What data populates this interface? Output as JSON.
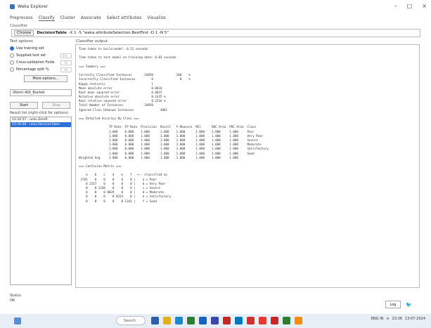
{
  "window": {
    "title": "Weka Explorer",
    "controls": [
      "–",
      "□",
      "×"
    ]
  },
  "tabs": [
    "Preprocess",
    "Classify",
    "Cluster",
    "Associate",
    "Select attributes",
    "Visualize"
  ],
  "active_tab": 1,
  "classifier": {
    "section_label": "Classifier",
    "choose_label": "Choose",
    "name": "DecisionTable",
    "options": "-X 1 -S \"weka.attributeSelection.BestFirst -D 1 -N 5\""
  },
  "test_options": {
    "label": "Test options",
    "items": [
      {
        "label": "Use training set",
        "selected": true,
        "value": ""
      },
      {
        "label": "Supplied test set",
        "selected": false,
        "value": "Set..."
      },
      {
        "label": "Cross-validation  Folds",
        "selected": false,
        "value": "10"
      },
      {
        "label": "Percentage split  %",
        "selected": false,
        "value": "66"
      }
    ],
    "more_options": "More options..."
  },
  "class_select": "(Nom) AQI_Bucket",
  "start_label": "Start",
  "stop_label": "Stop",
  "result_list": {
    "label": "Result list (right-click for options)",
    "items": [
      {
        "text": "23:34:57 - rules.ZeroR",
        "selected": false
      },
      {
        "text": "23:36:08 - rules.DecisionTable",
        "selected": true
      }
    ]
  },
  "output": {
    "label": "Classifier output",
    "lines": [
      "Time taken to build model: 0.11 seconds",
      "",
      "Time taken to test model on training data: 0.03 seconds",
      "",
      "=== Summary ===",
      "",
      "Correctly Classified Instances       24850             100    %",
      "Incorrectly Classified Instances         0               0    %",
      "Kappa statistic                          1",
      "Mean absolute error                      0.0034",
      "Root mean squared error                  0.0037",
      "Relative absolute error                  0.1435 %",
      "Root relative squared error              0.2216 %",
      "Total Number of Instances            24850",
      "Ignored Class Unknown Instances               4681",
      "",
      "=== Detailed Accuracy By Class ===",
      "",
      "                 TP Rate  FP Rate  Precision  Recall   F-Measure  MCC      ROC Area  PRC Area  Class",
      "                 1.000    0.000    1.000      1.000    1.000      1.000    1.000     1.000     Poor",
      "                 1.000    0.000    1.000      1.000    1.000      1.000    1.000     1.000     Very Poor",
      "                 1.000    0.000    1.000      1.000    1.000      1.000    1.000     1.000     Severe",
      "                 1.000    0.000    1.000      1.000    1.000      1.000    1.000     1.000     Moderate",
      "                 1.000    0.000    1.000      1.000    1.000      1.000    1.000     1.000     Satisfactory",
      "                 1.000    0.000    1.000      1.000    1.000      1.000    1.000     1.000     Good",
      "Weighted Avg.    1.000    0.000    1.000      1.000    1.000      1.000    1.000     1.000",
      "",
      "=== Confusion Matrix ===",
      "",
      "    a    b    c    d    e    f   <-- classified as",
      " 2781    0    0    0    0    0 |    a = Poor",
      "    0 2337    0    0    0    0 |    b = Very Poor",
      "    0    0 1338    0    0    0 |    c = Severe",
      "    0    0    0 8829    0    0 |    d = Moderate",
      "    0    0    0    0 8224    0 |    e = Satisfactory",
      "    0    0    0    0    0 1341 |    f = Good"
    ]
  },
  "status": {
    "label": "Status",
    "text": "OK"
  },
  "log_label": "Log",
  "taskbar": {
    "search": "Search",
    "time": "23:36",
    "date": "13-07-2024",
    "lang": "ENG IN"
  }
}
